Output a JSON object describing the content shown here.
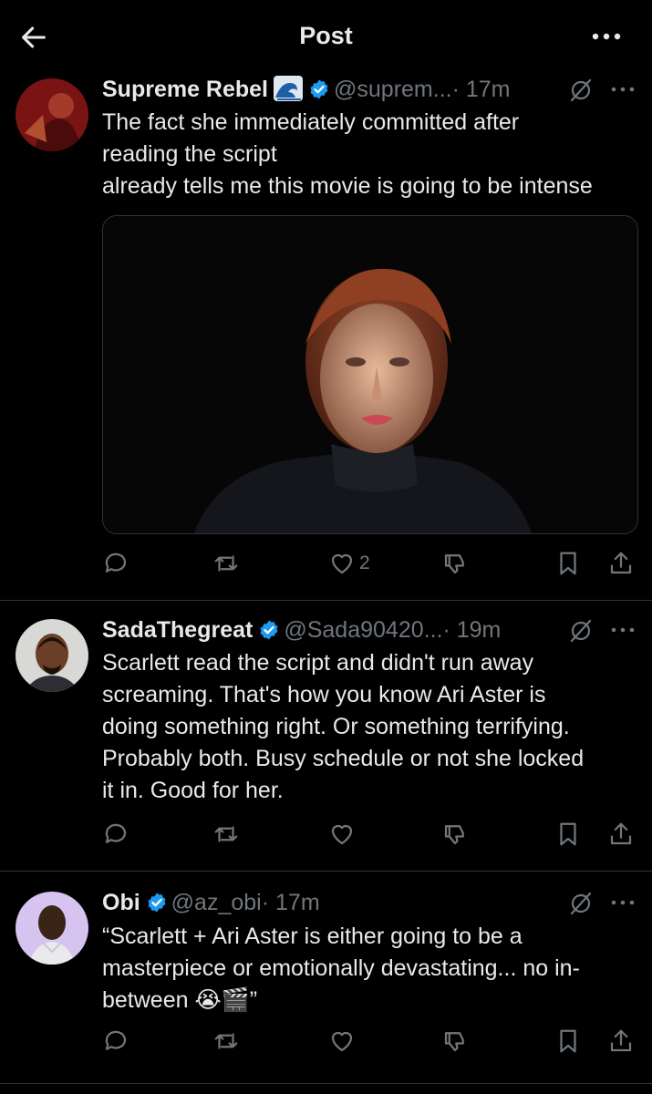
{
  "header": {
    "title": "Post"
  },
  "posts": [
    {
      "name": "Supreme Rebel",
      "handle": "@suprem...",
      "time": "· 17m",
      "lines": [
        "The fact she immediately committed after",
        "reading the script",
        "already tells me this movie is going to be intense"
      ],
      "counts": {
        "reply": "",
        "repost": "",
        "like": "2",
        "views": ""
      }
    },
    {
      "name": "SadaThegreat",
      "handle": "@Sada90420...",
      "time": "· 19m",
      "lines": [
        "Scarlett read the script and didn't run away",
        "screaming. That's how you know Ari Aster is",
        "doing something right. Or something terrifying.",
        "Probably both. Busy schedule or not she locked",
        "it in. Good for her."
      ],
      "counts": {
        "reply": "",
        "repost": "",
        "like": "",
        "views": ""
      }
    },
    {
      "name": "Obi",
      "handle": "@az_obi",
      "time": "· 17m",
      "lines": [
        "“Scarlett + Ari Aster is either going to be a",
        "masterpiece or emotionally devastating... no in-",
        "between 😭🎬”"
      ],
      "counts": {
        "reply": "",
        "repost": "",
        "like": "",
        "views": ""
      }
    }
  ],
  "colors": {
    "background": "#000000",
    "text": "#e7e9ea",
    "muted": "#71767b",
    "verified": "#1d9bf0",
    "divider": "#2f3336"
  }
}
